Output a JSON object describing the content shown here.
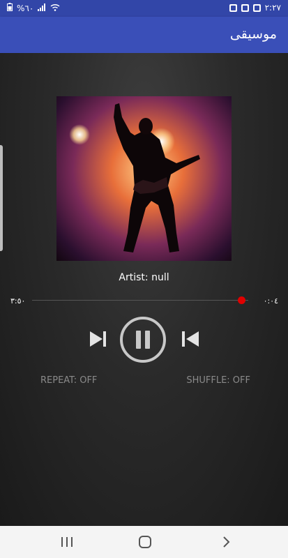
{
  "status_bar": {
    "time": "٢:٢٧",
    "battery": "%٦٠",
    "icons": [
      "shield-check-icon",
      "p-icon",
      "image-icon",
      "signal-icon",
      "wifi-icon",
      "battery-icon"
    ]
  },
  "app_bar": {
    "title": "موسيقى",
    "color": "#3a4fb8"
  },
  "player": {
    "artist": "Artist: null",
    "time_elapsed": "٣:٥٠",
    "time_total": "٠:٠٤",
    "progress": 0.97,
    "seek_color": "#e00000",
    "repeat_label": "REPEAT: OFF",
    "shuffle_label": "SHUFFLE: OFF",
    "state": "playing",
    "controls": [
      "next-icon",
      "pause-icon",
      "previous-icon"
    ]
  },
  "nav_bar": {
    "items": [
      "recent-apps-icon",
      "home-icon",
      "back-icon"
    ]
  }
}
